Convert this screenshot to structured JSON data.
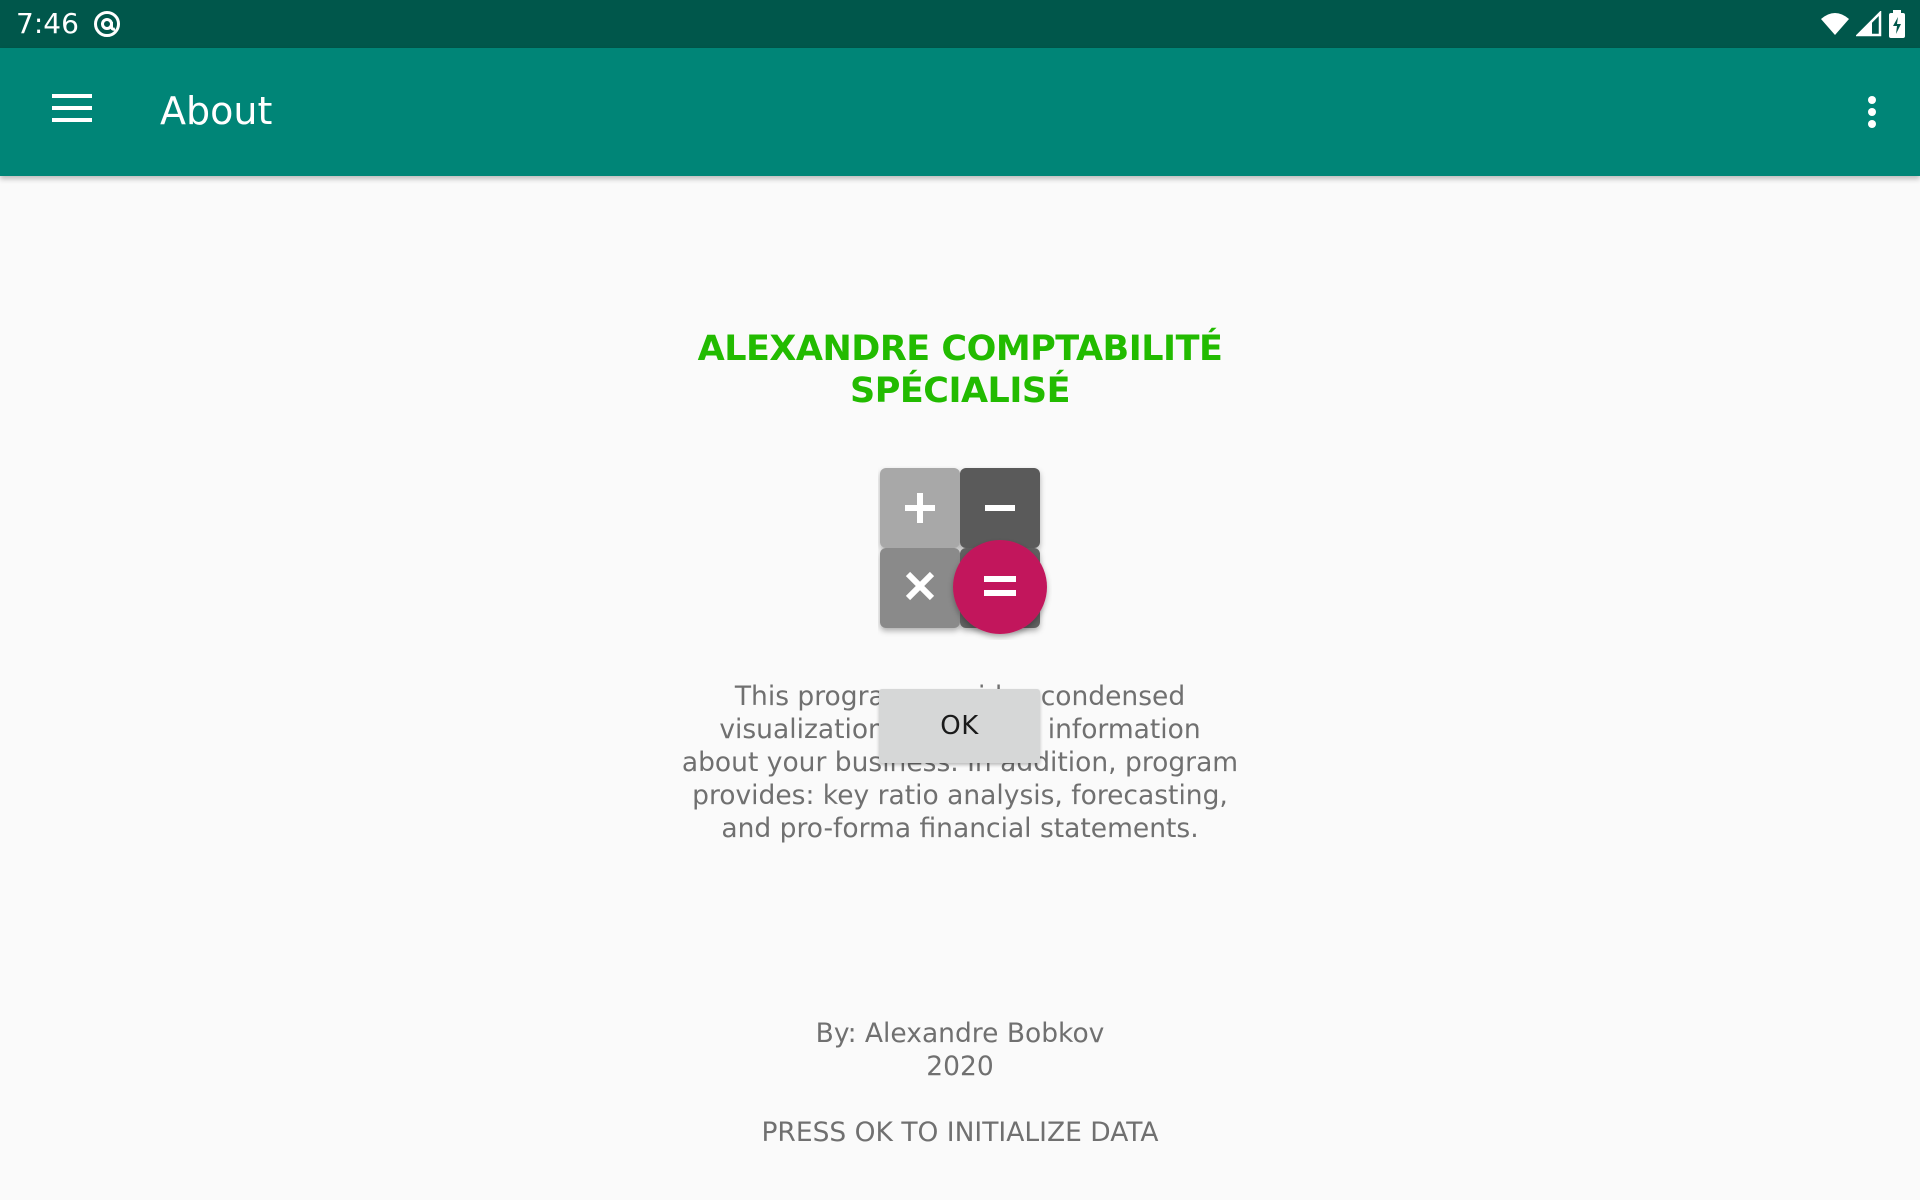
{
  "status_bar": {
    "time": "7:46",
    "icons": [
      "at-sign-icon",
      "wifi-icon",
      "cell-signal-icon",
      "battery-charging-icon"
    ]
  },
  "app_bar": {
    "title": "About",
    "menu_icon": "hamburger-menu-icon",
    "overflow_icon": "more-vert-icon"
  },
  "about": {
    "company_name_line1": "ALEXANDRE COMPTABILITÉ",
    "company_name_line2": "SPÉCIALISÉ",
    "logo_icon": "calculator-icon",
    "description_lines": [
      "This program provides condensed",
      "visualization of financial information",
      "about your business. In addition, program",
      "provides: key ratio analysis, forecasting,",
      "and pro-forma financial statements."
    ],
    "ok_label": "OK",
    "author": "By: Alexandre Bobkov",
    "year": "2020",
    "hint": "PRESS OK TO INITIALIZE DATA"
  },
  "colors": {
    "status_bar": "#00574b",
    "app_bar": "#008577",
    "company_name": "#22bb00",
    "body_text": "#707070",
    "button": "#d6d7d7",
    "logo_accent": "#c2185b",
    "background": "#fafafa"
  }
}
